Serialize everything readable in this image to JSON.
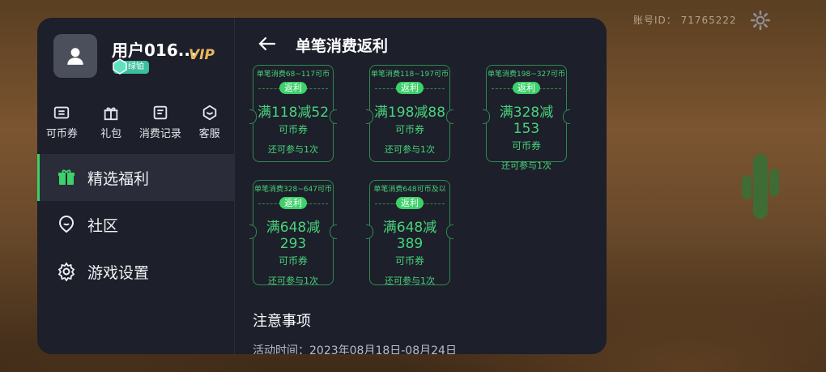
{
  "header": {
    "account_id": "账号ID： 71765222"
  },
  "user": {
    "name": "用户016...",
    "vip": "VIP",
    "badge": "绿铂"
  },
  "quick_actions": [
    {
      "label": "可币券",
      "icon": "ticket-icon"
    },
    {
      "label": "礼包",
      "icon": "gift-icon"
    },
    {
      "label": "消费记录",
      "icon": "receipt-icon"
    },
    {
      "label": "客服",
      "icon": "service-icon"
    }
  ],
  "nav": [
    {
      "label": "精选福利",
      "icon": "gift-box-icon",
      "active": true
    },
    {
      "label": "社区",
      "icon": "community-icon",
      "active": false
    },
    {
      "label": "游戏设置",
      "icon": "settings-icon",
      "active": false
    }
  ],
  "main": {
    "title": "单笔消费返利",
    "coupons": [
      {
        "rule": "单笔消费68~117可币",
        "tag": "返利",
        "amount": "满118减52",
        "unit": "可币券",
        "note": "还可参与1次"
      },
      {
        "rule": "单笔消费118~197可币",
        "tag": "返利",
        "amount": "满198减88",
        "unit": "可币券",
        "note": "还可参与1次"
      },
      {
        "rule": "单笔消费198~327可币",
        "tag": "返利",
        "amount": "满328减153",
        "unit": "可币券",
        "note": "还可参与1次"
      },
      {
        "rule": "单笔消费328~647可币",
        "tag": "返利",
        "amount": "满648减293",
        "unit": "可币券",
        "note": "还可参与1次"
      },
      {
        "rule": "单笔消费648可币及以",
        "tag": "返利",
        "amount": "满648减389",
        "unit": "可币券",
        "note": "还可参与1次"
      }
    ],
    "notice_title": "注意事项",
    "notice_text": "活动时间：2023年08月18日-08月24日"
  },
  "colors": {
    "accent": "#3dd06b",
    "panel_bg": "#1d1f2a",
    "vip": "#e8b85c"
  }
}
